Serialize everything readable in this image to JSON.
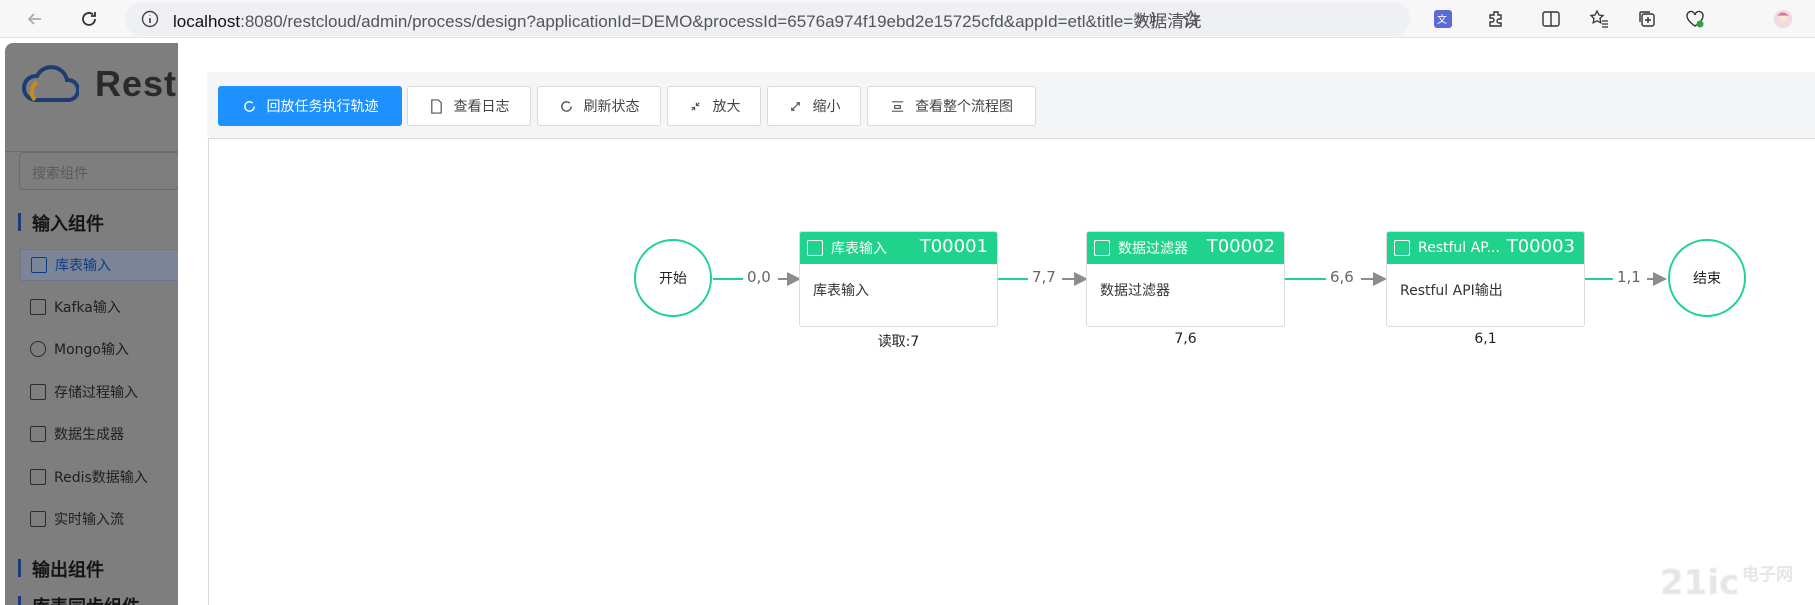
{
  "browser": {
    "url_host": "localhost",
    "url_rest": ":8080/restcloud/admin/process/design?applicationId=DEMO&processId=6576a974f19ebd2e15725cfd&appId=etl&title=数据清洗"
  },
  "sidebar": {
    "logo_text": "RestC",
    "search_placeholder": "搜索组件",
    "group_input": "输入组件",
    "items": [
      {
        "label": "库表输入",
        "icon": "table-input-icon",
        "selected": true
      },
      {
        "label": "Kafka输入",
        "icon": "kafka-icon"
      },
      {
        "label": "Mongo输入",
        "icon": "mongo-icon"
      },
      {
        "label": "存储过程输入",
        "icon": "procedure-icon"
      },
      {
        "label": "数据生成器",
        "icon": "generator-icon"
      },
      {
        "label": "Redis数据输入",
        "icon": "redis-icon"
      },
      {
        "label": "实时输入流",
        "icon": "stream-icon"
      }
    ],
    "group_output": "输出组件",
    "group_partial": "库表同步组件"
  },
  "toolbar": {
    "replay": "回放任务执行轨迹",
    "log": "查看日志",
    "refresh": "刷新状态",
    "zoom_in": "放大",
    "zoom_out": "缩小",
    "fit": "查看整个流程图"
  },
  "flow": {
    "start": "开始",
    "end": "结束",
    "tasks": [
      {
        "name": "库表输入",
        "id": "T00001",
        "body": "库表输入",
        "stat": "读取:7"
      },
      {
        "name": "数据过滤器",
        "id": "T00002",
        "body": "数据过滤器",
        "stat": "7,6"
      },
      {
        "name": "Restful AP...",
        "id": "T00003",
        "body": "Restful API输出",
        "stat": "6,1"
      }
    ],
    "edges": [
      "0,0",
      "7,7",
      "6,6",
      "1,1"
    ]
  },
  "colors": {
    "accent": "#1e90ff",
    "node": "#1fd38c"
  }
}
